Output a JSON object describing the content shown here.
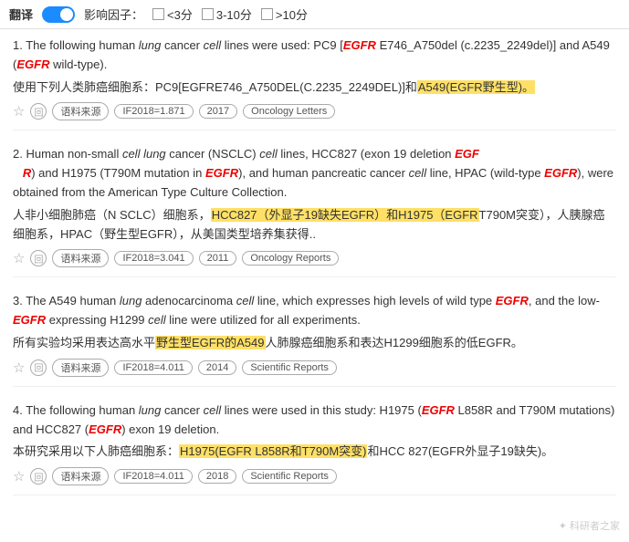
{
  "topbar": {
    "translate_label": "翻译",
    "toggle_on": true,
    "filter_label": "影响因子：",
    "filters": [
      {
        "label": "<3分",
        "checked": false
      },
      {
        "label": "3-10分",
        "checked": false
      },
      {
        "label": ">10分",
        "checked": false
      }
    ]
  },
  "results": [
    {
      "number": "1.",
      "en_html": "The following human <em>lung</em> cancer <em>cell</em> lines were used: PC9 [<span class='italic-red'>EGFR</span> E746_A750del (c.2235_2249del)] and A549 (<span class='italic-red'>EGFR</span> wild-type).",
      "zh_html": "使用下列人类肺癌细胞系：PC9[EGFRE746_A750DEL(C.2235_2249DEL)]和<span class='highlight-yellow'>A549(EGFR野生型)。</span>",
      "meta": {
        "if_value": "IF2018=1.871",
        "year": "2017",
        "journal": "Oncology Letters"
      }
    },
    {
      "number": "2.",
      "en_html": "Human non-small <em>cell lung</em> cancer (NSCLC) <em>cell</em> lines, HCC827 (exon 19 deletion <span class='italic-red'>EGF R</span>) and H1975 (T790M mutation in <span class='italic-red'>EGFR</span>), and human pancreatic cancer <em>cell</em> line, HPAC (wild-type <span class='italic-red'>EGFR</span>), were obtained from the American Type Culture Collection.",
      "zh_html": "人非小细胞肺癌（N SCLC）细胞系，<span class='highlight-yellow'>HCC827（外显子19缺失EGFR）和H1975（EGFR</span>T790M突变），人胰腺癌细胞系，HPAC（野生型EGFR），从美国类型培养集获得..",
      "meta": {
        "if_value": "IF2018=3.041",
        "year": "2011",
        "journal": "Oncology Reports"
      }
    },
    {
      "number": "3.",
      "en_html": "The A549 human <em>lung</em> adenocarcinoma <em>cell</em> line, which expresses high levels of wild type <span class='italic-red'>EGFR</span>, and the low-<span class='italic-red'>EGFR</span> expressing H1299 <em>cell</em> line were utilized for all experiments.",
      "zh_html": "所有实验均采用表达高水平<span class='highlight-yellow'>野生型EGFR的A549</span>人肺腺癌细胞系和表达H1299细胞系的低EGFR。",
      "meta": {
        "if_value": "IF2018=4.011",
        "year": "2014",
        "journal": "Scientific Reports"
      }
    },
    {
      "number": "4.",
      "en_html": "The following human <em>lung</em> cancer <em>cell</em> lines were used in this study: H1975 (<span class='italic-red'>EGFR</span> L858R and T790M mutations) and HCC827 (<span class='italic-red'>EGFR</span>) exon 19 deletion.",
      "zh_html": "本研究采用以下人肺癌细胞系：<span class='highlight-yellow'>H1975(EGFR L858R和T790M突变)</span>和HCC 827(EGFR外显子19缺失)。",
      "meta": {
        "if_value": "IF2018=4.011",
        "year": "2018",
        "journal": "Scientific Reports"
      }
    }
  ],
  "watermark": "科研者之家",
  "labels": {
    "source": "语料来源",
    "star": "☆",
    "round": "回"
  }
}
